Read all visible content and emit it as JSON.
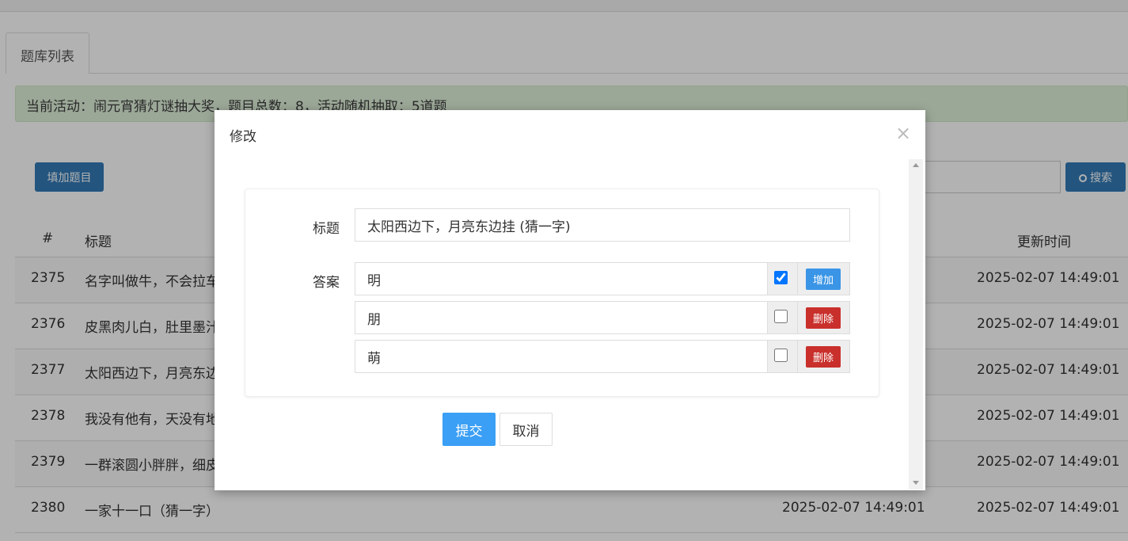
{
  "tab": {
    "label": "题库列表"
  },
  "alert": {
    "text": "当前活动：闹元宵猜灯谜抽大奖，题目总数：8，活动随机抽取：5道题"
  },
  "toolbar": {
    "add_label": "填加题目",
    "search_label": "搜索",
    "search_value": ""
  },
  "table": {
    "headers": {
      "id": "#",
      "title": "标题",
      "updated": "更新时间"
    },
    "rows": [
      {
        "id": "2375",
        "title": "名字叫做牛，不会拉车",
        "created": "",
        "updated": "2025-02-07 14:49:01"
      },
      {
        "id": "2376",
        "title": "皮黑肉儿白，肚里墨汁",
        "created": "",
        "updated": "2025-02-07 14:49:01"
      },
      {
        "id": "2377",
        "title": "太阳西边下，月亮东边挂",
        "created": "",
        "updated": "2025-02-07 14:49:01"
      },
      {
        "id": "2378",
        "title": "我没有他有，天没有地",
        "created": "",
        "updated": "2025-02-07 14:49:01"
      },
      {
        "id": "2379",
        "title": "一群滚圆小胖胖，细皮",
        "created": "",
        "updated": "2025-02-07 14:49:01"
      },
      {
        "id": "2380",
        "title": "一家十一口（猜一字）",
        "created": "2025-02-07 14:49:01",
        "updated": "2025-02-07 14:49:01"
      }
    ]
  },
  "modal": {
    "title": "修改",
    "close_glyph": "×",
    "form": {
      "title_label": "标题",
      "title_value": "太阳西边下，月亮东边挂 (猜一字)",
      "answer_label": "答案",
      "answers": [
        {
          "value": "明",
          "checked": true,
          "action": "增加"
        },
        {
          "value": "朋",
          "checked": false,
          "action": "删除"
        },
        {
          "value": "萌",
          "checked": false,
          "action": "删除"
        }
      ]
    },
    "submit_label": "提交",
    "cancel_label": "取消"
  },
  "colors": {
    "primary": "#337ab7",
    "accent": "#3a9ff5",
    "danger": "#c9302c",
    "success_bg": "#dff0d8"
  }
}
